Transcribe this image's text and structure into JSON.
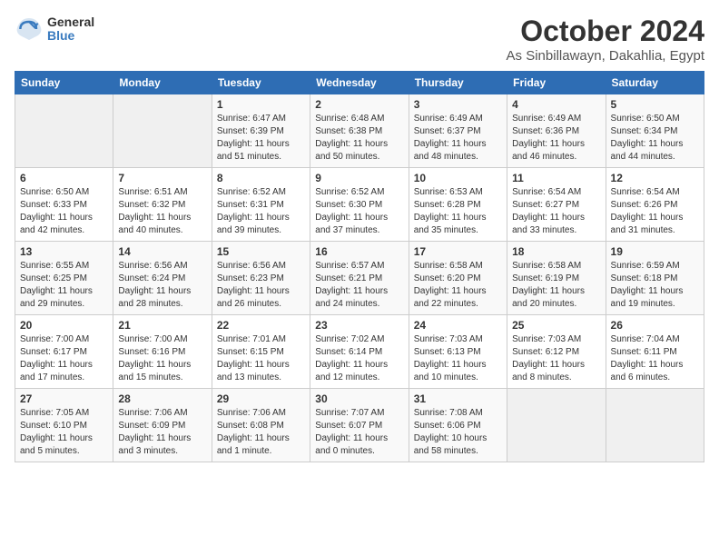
{
  "logo": {
    "general": "General",
    "blue": "Blue"
  },
  "title": "October 2024",
  "location": "As Sinbillawayn, Dakahlia, Egypt",
  "headers": [
    "Sunday",
    "Monday",
    "Tuesday",
    "Wednesday",
    "Thursday",
    "Friday",
    "Saturday"
  ],
  "weeks": [
    [
      {
        "day": "",
        "sunrise": "",
        "sunset": "",
        "daylight": ""
      },
      {
        "day": "",
        "sunrise": "",
        "sunset": "",
        "daylight": ""
      },
      {
        "day": "1",
        "sunrise": "Sunrise: 6:47 AM",
        "sunset": "Sunset: 6:39 PM",
        "daylight": "Daylight: 11 hours and 51 minutes."
      },
      {
        "day": "2",
        "sunrise": "Sunrise: 6:48 AM",
        "sunset": "Sunset: 6:38 PM",
        "daylight": "Daylight: 11 hours and 50 minutes."
      },
      {
        "day": "3",
        "sunrise": "Sunrise: 6:49 AM",
        "sunset": "Sunset: 6:37 PM",
        "daylight": "Daylight: 11 hours and 48 minutes."
      },
      {
        "day": "4",
        "sunrise": "Sunrise: 6:49 AM",
        "sunset": "Sunset: 6:36 PM",
        "daylight": "Daylight: 11 hours and 46 minutes."
      },
      {
        "day": "5",
        "sunrise": "Sunrise: 6:50 AM",
        "sunset": "Sunset: 6:34 PM",
        "daylight": "Daylight: 11 hours and 44 minutes."
      }
    ],
    [
      {
        "day": "6",
        "sunrise": "Sunrise: 6:50 AM",
        "sunset": "Sunset: 6:33 PM",
        "daylight": "Daylight: 11 hours and 42 minutes."
      },
      {
        "day": "7",
        "sunrise": "Sunrise: 6:51 AM",
        "sunset": "Sunset: 6:32 PM",
        "daylight": "Daylight: 11 hours and 40 minutes."
      },
      {
        "day": "8",
        "sunrise": "Sunrise: 6:52 AM",
        "sunset": "Sunset: 6:31 PM",
        "daylight": "Daylight: 11 hours and 39 minutes."
      },
      {
        "day": "9",
        "sunrise": "Sunrise: 6:52 AM",
        "sunset": "Sunset: 6:30 PM",
        "daylight": "Daylight: 11 hours and 37 minutes."
      },
      {
        "day": "10",
        "sunrise": "Sunrise: 6:53 AM",
        "sunset": "Sunset: 6:28 PM",
        "daylight": "Daylight: 11 hours and 35 minutes."
      },
      {
        "day": "11",
        "sunrise": "Sunrise: 6:54 AM",
        "sunset": "Sunset: 6:27 PM",
        "daylight": "Daylight: 11 hours and 33 minutes."
      },
      {
        "day": "12",
        "sunrise": "Sunrise: 6:54 AM",
        "sunset": "Sunset: 6:26 PM",
        "daylight": "Daylight: 11 hours and 31 minutes."
      }
    ],
    [
      {
        "day": "13",
        "sunrise": "Sunrise: 6:55 AM",
        "sunset": "Sunset: 6:25 PM",
        "daylight": "Daylight: 11 hours and 29 minutes."
      },
      {
        "day": "14",
        "sunrise": "Sunrise: 6:56 AM",
        "sunset": "Sunset: 6:24 PM",
        "daylight": "Daylight: 11 hours and 28 minutes."
      },
      {
        "day": "15",
        "sunrise": "Sunrise: 6:56 AM",
        "sunset": "Sunset: 6:23 PM",
        "daylight": "Daylight: 11 hours and 26 minutes."
      },
      {
        "day": "16",
        "sunrise": "Sunrise: 6:57 AM",
        "sunset": "Sunset: 6:21 PM",
        "daylight": "Daylight: 11 hours and 24 minutes."
      },
      {
        "day": "17",
        "sunrise": "Sunrise: 6:58 AM",
        "sunset": "Sunset: 6:20 PM",
        "daylight": "Daylight: 11 hours and 22 minutes."
      },
      {
        "day": "18",
        "sunrise": "Sunrise: 6:58 AM",
        "sunset": "Sunset: 6:19 PM",
        "daylight": "Daylight: 11 hours and 20 minutes."
      },
      {
        "day": "19",
        "sunrise": "Sunrise: 6:59 AM",
        "sunset": "Sunset: 6:18 PM",
        "daylight": "Daylight: 11 hours and 19 minutes."
      }
    ],
    [
      {
        "day": "20",
        "sunrise": "Sunrise: 7:00 AM",
        "sunset": "Sunset: 6:17 PM",
        "daylight": "Daylight: 11 hours and 17 minutes."
      },
      {
        "day": "21",
        "sunrise": "Sunrise: 7:00 AM",
        "sunset": "Sunset: 6:16 PM",
        "daylight": "Daylight: 11 hours and 15 minutes."
      },
      {
        "day": "22",
        "sunrise": "Sunrise: 7:01 AM",
        "sunset": "Sunset: 6:15 PM",
        "daylight": "Daylight: 11 hours and 13 minutes."
      },
      {
        "day": "23",
        "sunrise": "Sunrise: 7:02 AM",
        "sunset": "Sunset: 6:14 PM",
        "daylight": "Daylight: 11 hours and 12 minutes."
      },
      {
        "day": "24",
        "sunrise": "Sunrise: 7:03 AM",
        "sunset": "Sunset: 6:13 PM",
        "daylight": "Daylight: 11 hours and 10 minutes."
      },
      {
        "day": "25",
        "sunrise": "Sunrise: 7:03 AM",
        "sunset": "Sunset: 6:12 PM",
        "daylight": "Daylight: 11 hours and 8 minutes."
      },
      {
        "day": "26",
        "sunrise": "Sunrise: 7:04 AM",
        "sunset": "Sunset: 6:11 PM",
        "daylight": "Daylight: 11 hours and 6 minutes."
      }
    ],
    [
      {
        "day": "27",
        "sunrise": "Sunrise: 7:05 AM",
        "sunset": "Sunset: 6:10 PM",
        "daylight": "Daylight: 11 hours and 5 minutes."
      },
      {
        "day": "28",
        "sunrise": "Sunrise: 7:06 AM",
        "sunset": "Sunset: 6:09 PM",
        "daylight": "Daylight: 11 hours and 3 minutes."
      },
      {
        "day": "29",
        "sunrise": "Sunrise: 7:06 AM",
        "sunset": "Sunset: 6:08 PM",
        "daylight": "Daylight: 11 hours and 1 minute."
      },
      {
        "day": "30",
        "sunrise": "Sunrise: 7:07 AM",
        "sunset": "Sunset: 6:07 PM",
        "daylight": "Daylight: 11 hours and 0 minutes."
      },
      {
        "day": "31",
        "sunrise": "Sunrise: 7:08 AM",
        "sunset": "Sunset: 6:06 PM",
        "daylight": "Daylight: 10 hours and 58 minutes."
      },
      {
        "day": "",
        "sunrise": "",
        "sunset": "",
        "daylight": ""
      },
      {
        "day": "",
        "sunrise": "",
        "sunset": "",
        "daylight": ""
      }
    ]
  ]
}
